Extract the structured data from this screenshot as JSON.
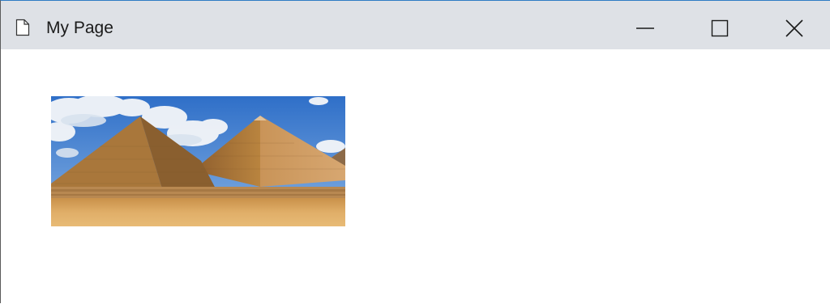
{
  "window": {
    "title": "My Page",
    "icons": {
      "document": "document-icon",
      "minimize": "minimize-icon",
      "maximize": "maximize-icon",
      "close": "close-icon"
    }
  },
  "content": {
    "image": {
      "subject": "pyramids-image"
    }
  },
  "colors": {
    "titlebar": "#dee1e6",
    "sky": "#3f79c9",
    "sand": "#d9a65a",
    "pyramid": "#bf8a4a"
  }
}
